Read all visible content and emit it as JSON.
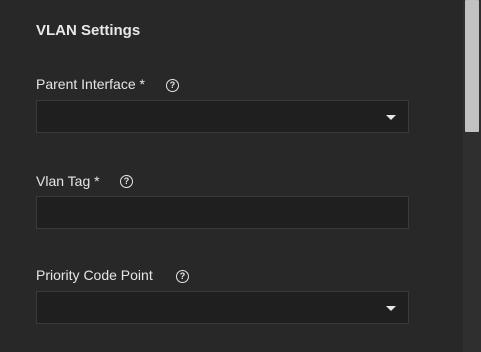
{
  "section": {
    "title": "VLAN Settings"
  },
  "fields": {
    "parent_interface": {
      "label": "Parent Interface *",
      "help_glyph": "?",
      "value": ""
    },
    "vlan_tag": {
      "label": "Vlan Tag *",
      "help_glyph": "?",
      "value": ""
    },
    "priority_code_point": {
      "label": "Priority Code Point",
      "help_glyph": "?",
      "value": ""
    }
  }
}
